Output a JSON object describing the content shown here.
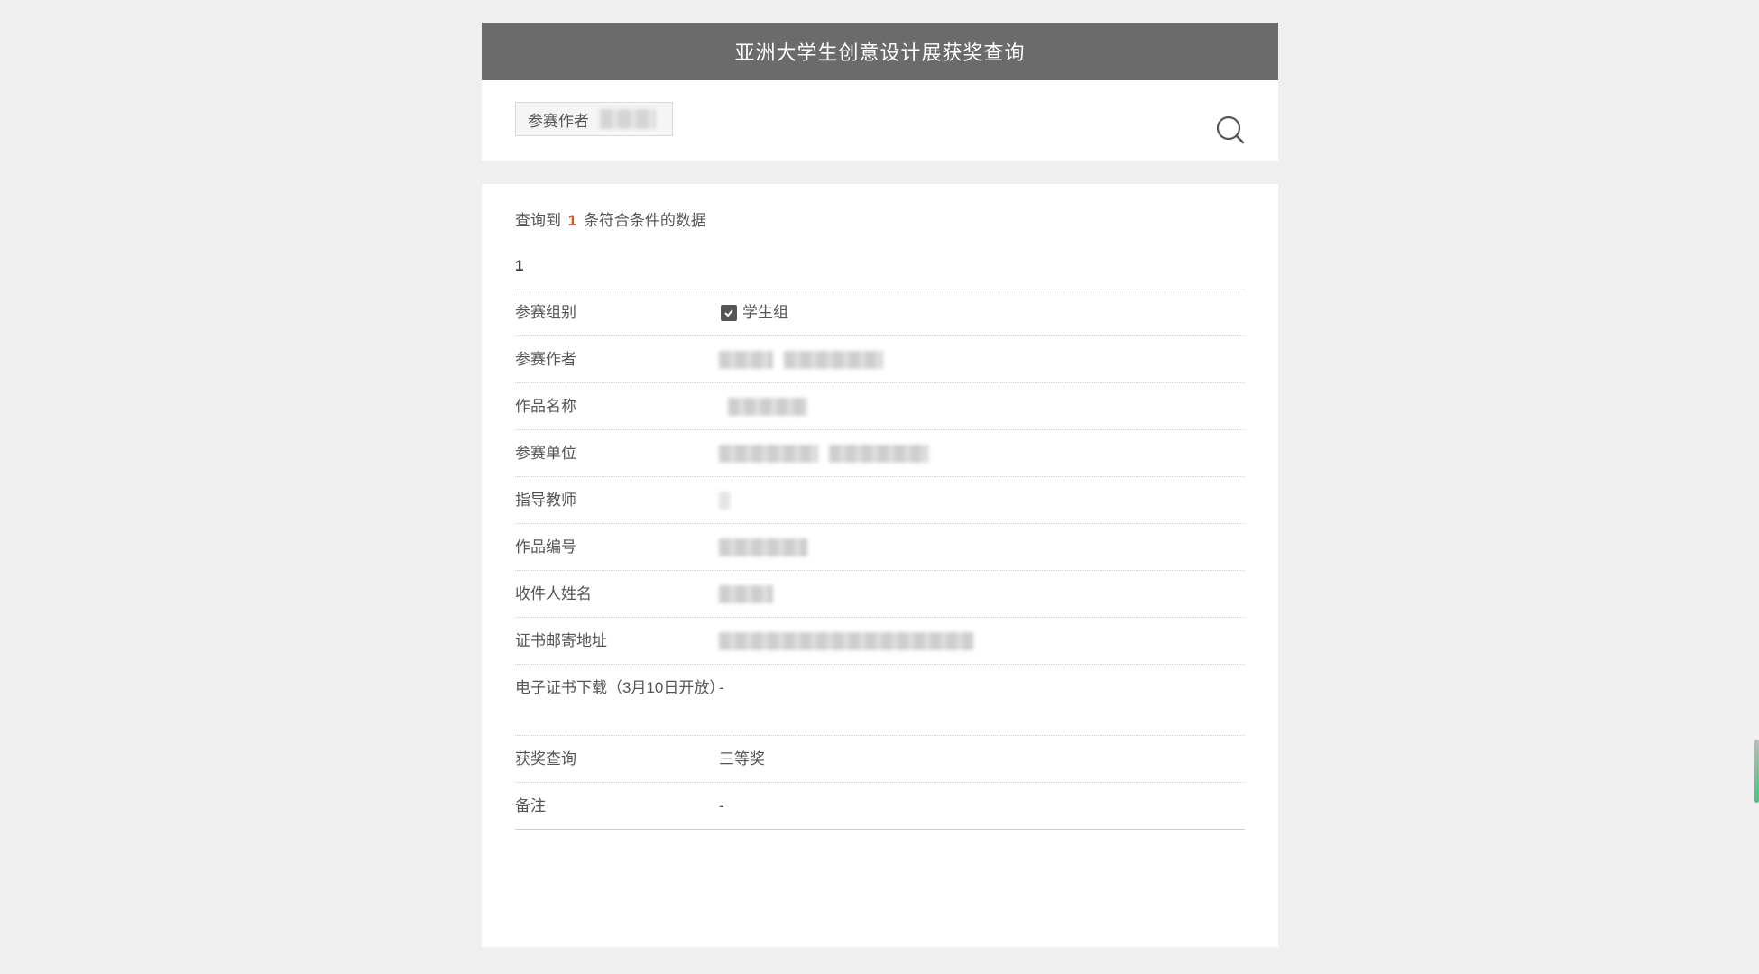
{
  "header": {
    "title": "亚洲大学生创意设计展获奖查询"
  },
  "search": {
    "filter_label": "参赛作者"
  },
  "results": {
    "summary_prefix": "查询到",
    "count": "1",
    "summary_suffix": "条符合条件的数据",
    "record_index": "1",
    "fields": {
      "group_label": "参赛组别",
      "group_value": "学生组",
      "author_label": "参赛作者",
      "work_name_label": "作品名称",
      "unit_label": "参赛单位",
      "teacher_label": "指导教师",
      "work_no_label": "作品编号",
      "recipient_label": "收件人姓名",
      "address_label": "证书邮寄地址",
      "ecert_label": "电子证书下载（3月10日开放）",
      "ecert_value": "-",
      "award_label": "获奖查询",
      "award_value": "三等奖",
      "remark_label": "备注",
      "remark_value": "-"
    }
  },
  "colors": {
    "header_bg": "#6b6b6b",
    "page_bg": "#efefef",
    "count_accent": "#d9541e"
  }
}
